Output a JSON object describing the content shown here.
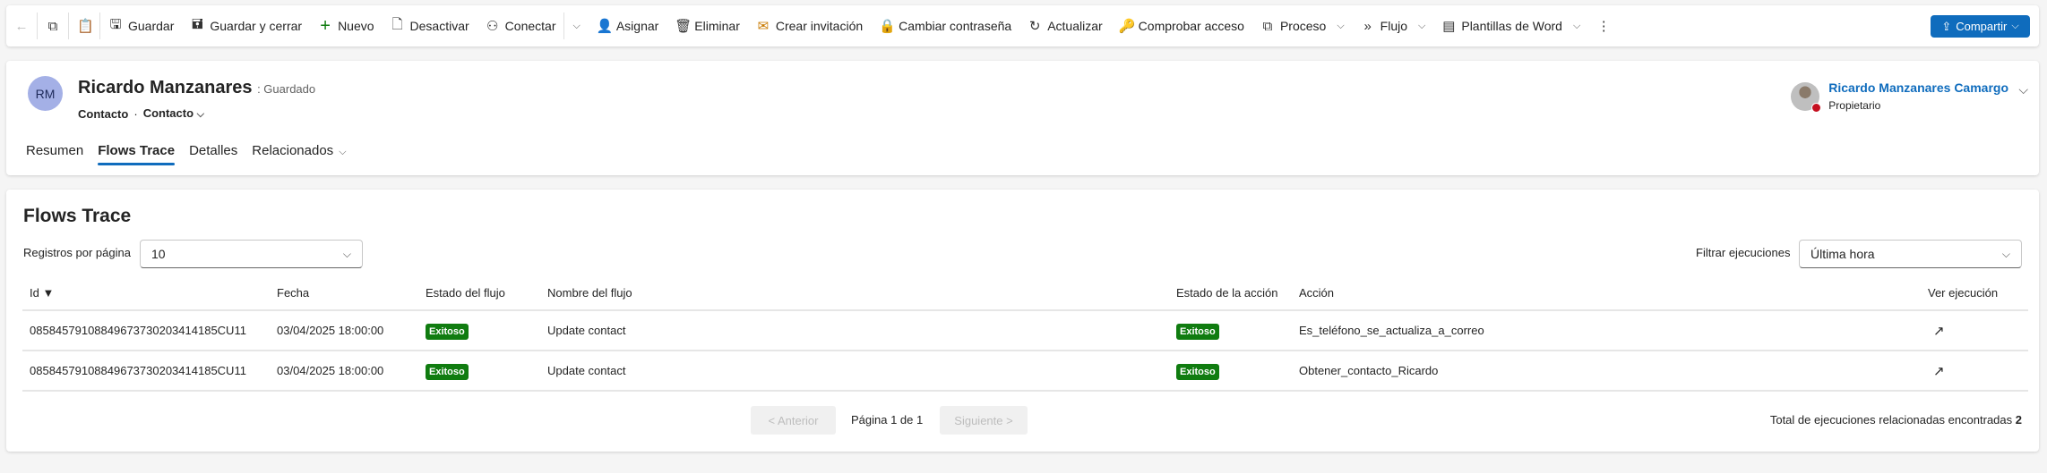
{
  "toolbar": {
    "items": [
      {
        "label": "Guardar",
        "icon": "save-icon",
        "glyph": "🖫"
      },
      {
        "label": "Guardar y cerrar",
        "icon": "save-close-icon",
        "glyph": "🖬"
      },
      {
        "label": "Nuevo",
        "icon": "plus-icon",
        "glyph": "+"
      },
      {
        "label": "Desactivar",
        "icon": "deactivate-icon",
        "glyph": "🗋"
      },
      {
        "label": "Conectar",
        "icon": "connect-icon",
        "glyph": "⚇"
      },
      {
        "label": "Asignar",
        "icon": "assign-icon",
        "glyph": "👤"
      },
      {
        "label": "Eliminar",
        "icon": "trash-icon",
        "glyph": "🗑"
      },
      {
        "label": "Crear invitación",
        "icon": "invite-icon",
        "glyph": "✉"
      },
      {
        "label": "Cambiar contraseña",
        "icon": "lock-icon",
        "glyph": "🔒"
      },
      {
        "label": "Actualizar",
        "icon": "refresh-icon",
        "glyph": "↻"
      },
      {
        "label": "Comprobar acceso",
        "icon": "key-icon",
        "glyph": "🔑"
      },
      {
        "label": "Proceso",
        "icon": "process-icon",
        "glyph": "⧉"
      },
      {
        "label": "Flujo",
        "icon": "flow-icon",
        "glyph": "»"
      },
      {
        "label": "Plantillas de Word",
        "icon": "word-icon",
        "glyph": "▤"
      }
    ],
    "share": "Compartir"
  },
  "record": {
    "initials": "RM",
    "name": "Ricardo Manzanares",
    "status": ": Guardado",
    "entity": "Contacto",
    "form": "Contacto"
  },
  "tabs": [
    "Resumen",
    "Flows Trace",
    "Detalles",
    "Relacionados"
  ],
  "owner": {
    "name": "Ricardo Manzanares Camargo",
    "role": "Propietario"
  },
  "flows": {
    "title": "Flows Trace",
    "per_page_label": "Registros por página",
    "per_page_value": "10",
    "filter_label": "Filtrar ejecuciones",
    "filter_value": "Última hora",
    "columns": [
      "Id ▼",
      "Fecha",
      "Estado del flujo",
      "Nombre del flujo",
      "Estado de la acción",
      "Acción",
      "Ver ejecución"
    ],
    "rows": [
      {
        "id": "08584579108849673730203414185CU11",
        "date": "03/04/2025 18:00:00",
        "flow_status": "Exitoso",
        "flow_name": "Update contact",
        "action_status": "Exitoso",
        "action": "Es_teléfono_se_actualiza_a_correo"
      },
      {
        "id": "08584579108849673730203414185CU11",
        "date": "03/04/2025 18:00:00",
        "flow_status": "Exitoso",
        "flow_name": "Update contact",
        "action_status": "Exitoso",
        "action": "Obtener_contacto_Ricardo"
      }
    ],
    "prev": "< Anterior",
    "page": "Página 1 de 1",
    "next": "Siguiente >",
    "total_label": "Total de ejecuciones relacionadas encontradas",
    "total": "2"
  }
}
